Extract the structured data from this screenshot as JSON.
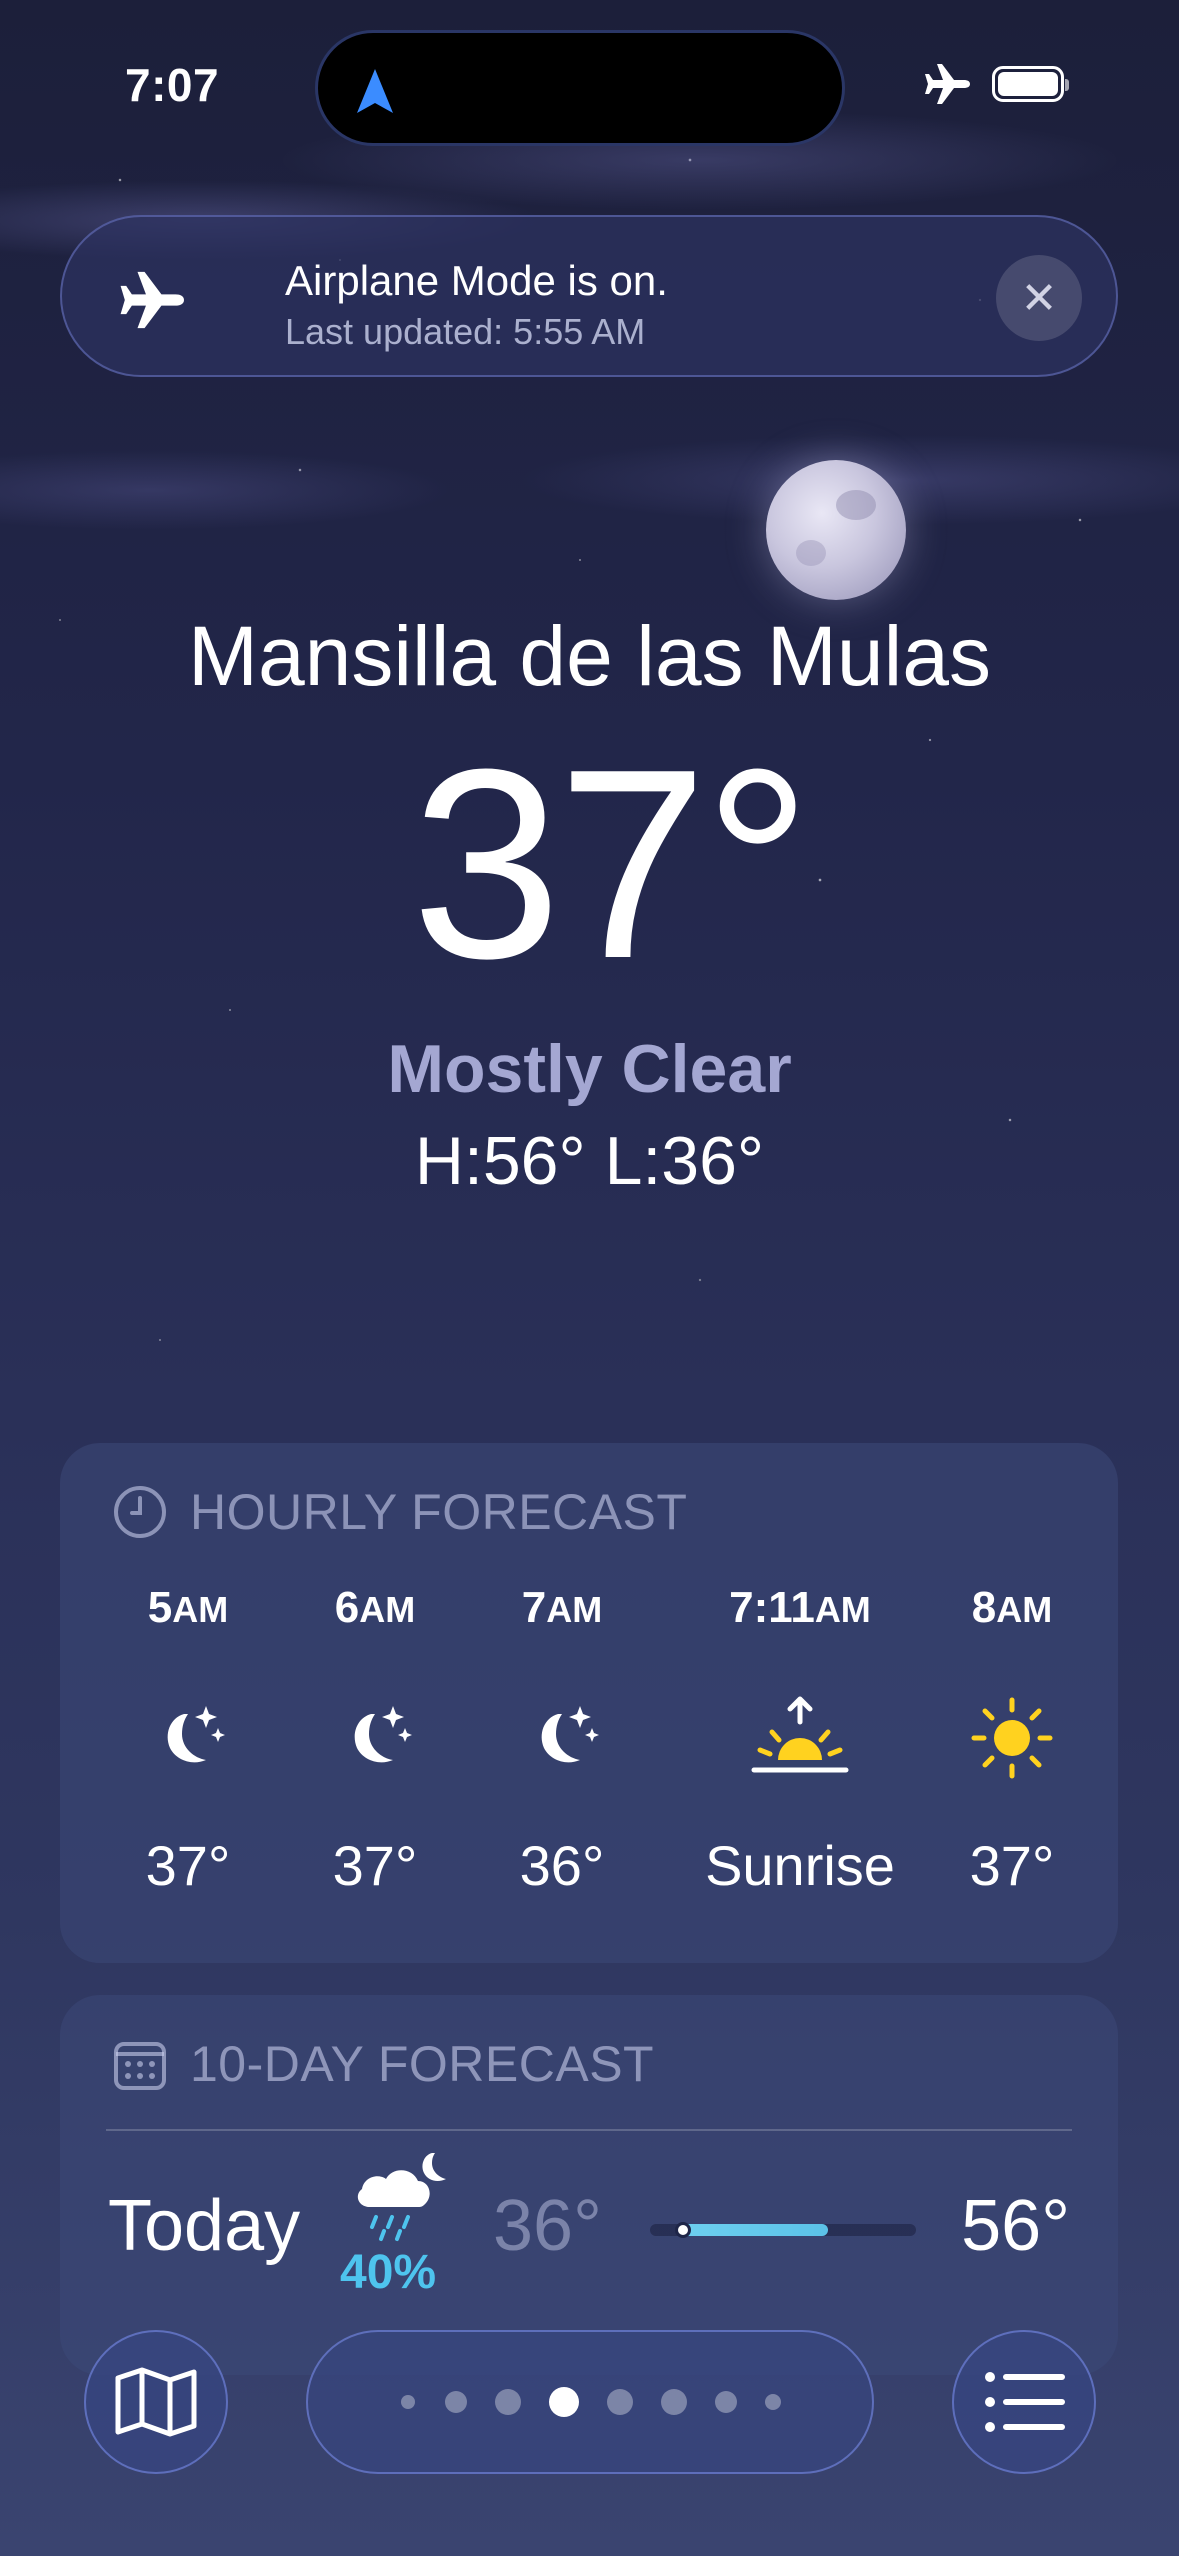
{
  "status_bar": {
    "time": "7:07"
  },
  "banner": {
    "title": "Airplane Mode is on.",
    "subtitle": "Last updated: 5:55 AM",
    "close_symbol": "✕"
  },
  "current": {
    "city": "Mansilla de las Mulas",
    "temperature": "37°",
    "condition": "Mostly Clear",
    "high_low": "H:56°  L:36°"
  },
  "hourly": {
    "heading": "HOURLY FORECAST",
    "items": [
      {
        "time": "5",
        "suffix": "AM",
        "icon": "moon-stars-icon",
        "temp": "37°"
      },
      {
        "time": "6",
        "suffix": "AM",
        "icon": "moon-stars-icon",
        "temp": "37°"
      },
      {
        "time": "7",
        "suffix": "AM",
        "icon": "moon-stars-icon",
        "temp": "36°"
      },
      {
        "time": "7:11",
        "suffix": "AM",
        "icon": "sunrise-icon",
        "temp": "Sunrise"
      },
      {
        "time": "8",
        "suffix": "AM",
        "icon": "sun-icon",
        "temp": "37°"
      }
    ]
  },
  "ten_day": {
    "heading": "10-DAY FORECAST",
    "today": {
      "day": "Today",
      "icon": "cloud-moon-rain-icon",
      "precip": "40%",
      "low": "36°",
      "high": "56°"
    }
  },
  "page_indicator": {
    "count": 8,
    "active_index": 3
  },
  "colors": {
    "accent": "#4ec4ee",
    "sun": "#ffd21f",
    "location_arrow": "#3b8cff"
  }
}
